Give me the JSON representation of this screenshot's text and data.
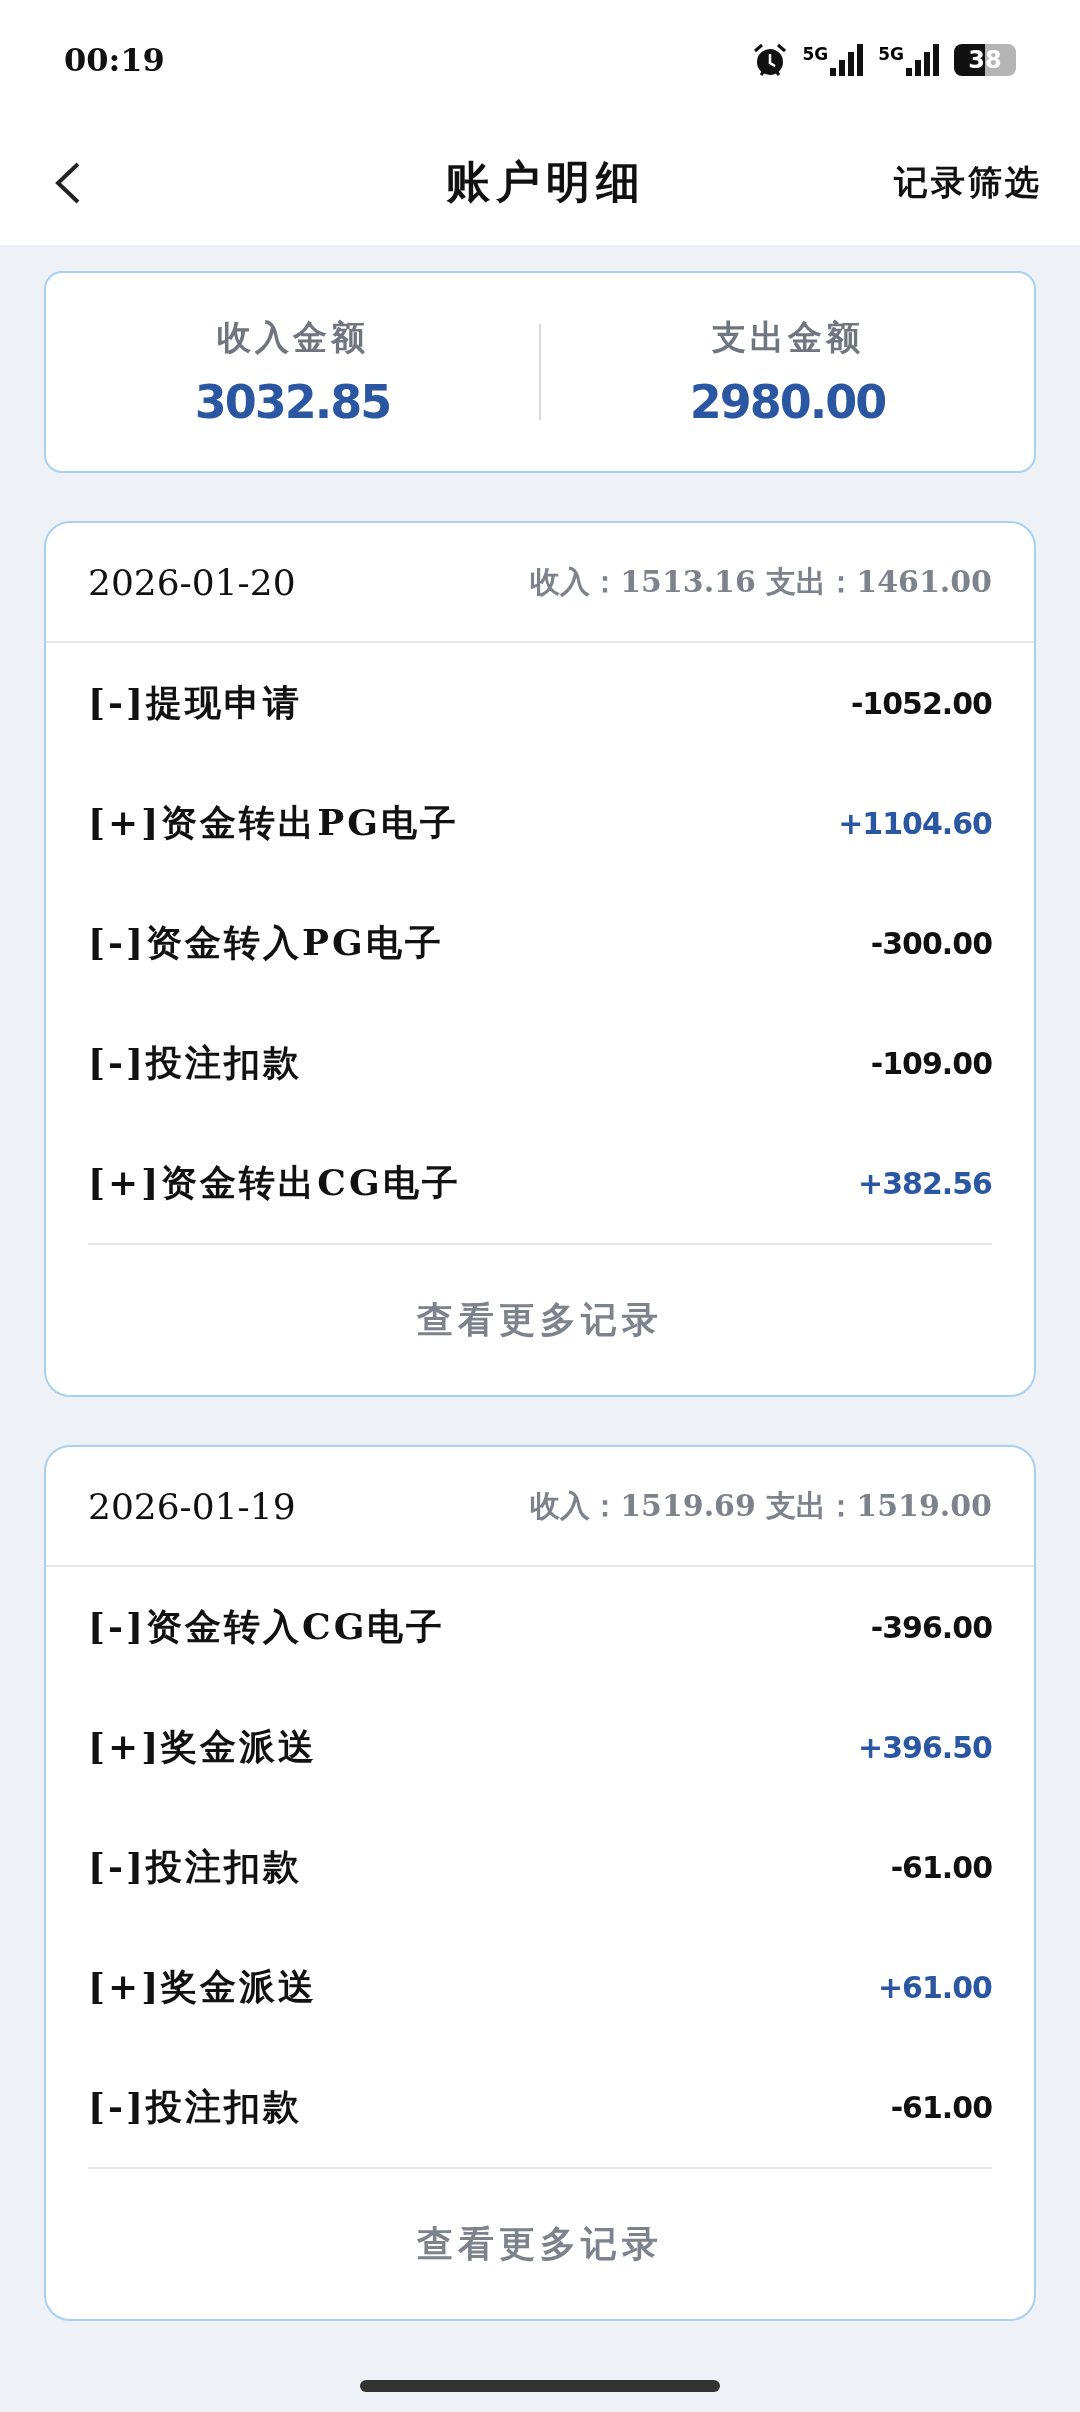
{
  "status_bar": {
    "time": "00:19",
    "network_1": "5G",
    "network_2": "5G",
    "battery": "38"
  },
  "header": {
    "title": "账户明细",
    "action": "记录筛选"
  },
  "summary": [
    {
      "label": "收入金额",
      "value": "3032.85"
    },
    {
      "label": "支出金额",
      "value": "2980.00"
    }
  ],
  "days": [
    {
      "date": "2026-01-20",
      "totals": "收入：1513.16 支出：1461.00",
      "more": "查看更多记录",
      "records": [
        {
          "label": "[-]提现申请",
          "amount": "-1052.00",
          "kind": "expense"
        },
        {
          "label": "[+]资金转出PG电子",
          "amount": "+1104.60",
          "kind": "income"
        },
        {
          "label": "[-]资金转入PG电子",
          "amount": "-300.00",
          "kind": "expense"
        },
        {
          "label": "[-]投注扣款",
          "amount": "-109.00",
          "kind": "expense"
        },
        {
          "label": "[+]资金转出CG电子",
          "amount": "+382.56",
          "kind": "income"
        }
      ]
    },
    {
      "date": "2026-01-19",
      "totals": "收入：1519.69 支出：1519.00",
      "more": "查看更多记录",
      "records": [
        {
          "label": "[-]资金转入CG电子",
          "amount": "-396.00",
          "kind": "expense"
        },
        {
          "label": "[+]奖金派送",
          "amount": "+396.50",
          "kind": "income"
        },
        {
          "label": "[-]投注扣款",
          "amount": "-61.00",
          "kind": "expense"
        },
        {
          "label": "[+]奖金派送",
          "amount": "+61.00",
          "kind": "income"
        },
        {
          "label": "[-]投注扣款",
          "amount": "-61.00",
          "kind": "expense"
        }
      ]
    }
  ]
}
